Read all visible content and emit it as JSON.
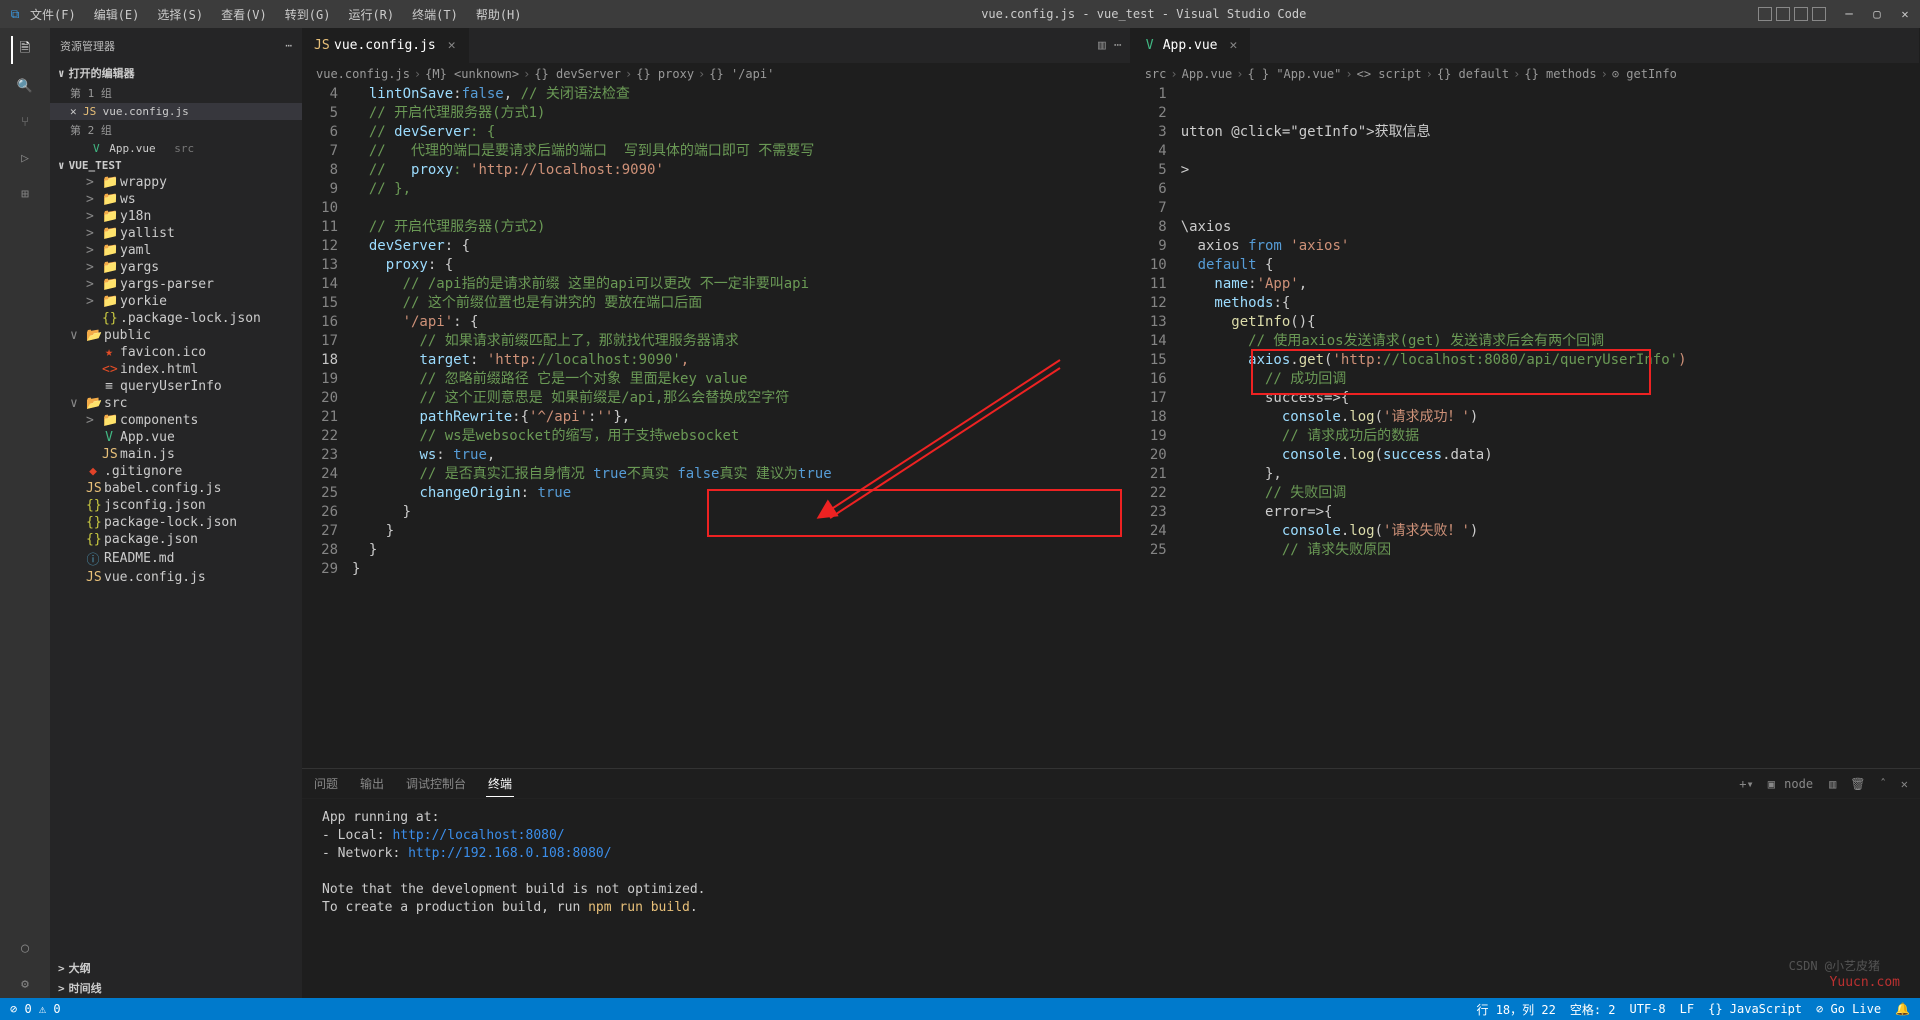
{
  "titlebar": {
    "menu": [
      "文件(F)",
      "编辑(E)",
      "选择(S)",
      "查看(V)",
      "转到(G)",
      "运行(R)",
      "终端(T)",
      "帮助(H)"
    ],
    "title": "vue.config.js - vue_test - Visual Studio Code"
  },
  "sidebar": {
    "header": "资源管理器",
    "openEditors": "打开的编辑器",
    "group1": "第 1 组",
    "group2": "第 2 组",
    "file1": "vue.config.js",
    "file2": "App.vue",
    "file2hint": "src",
    "project": "VUE_TEST",
    "tree": [
      {
        "indent": 1,
        "type": "folder",
        "chev": ">",
        "name": "wrappy"
      },
      {
        "indent": 1,
        "type": "folder",
        "chev": ">",
        "name": "ws"
      },
      {
        "indent": 1,
        "type": "folder",
        "chev": ">",
        "name": "y18n"
      },
      {
        "indent": 1,
        "type": "folder",
        "chev": ">",
        "name": "yallist"
      },
      {
        "indent": 1,
        "type": "folder",
        "chev": ">",
        "name": "yaml"
      },
      {
        "indent": 1,
        "type": "folder",
        "chev": ">",
        "name": "yargs"
      },
      {
        "indent": 1,
        "type": "folder",
        "chev": ">",
        "name": "yargs-parser"
      },
      {
        "indent": 1,
        "type": "folder",
        "chev": ">",
        "name": "yorkie"
      },
      {
        "indent": 1,
        "type": "json",
        "chev": "",
        "name": ".package-lock.json"
      },
      {
        "indent": 0,
        "type": "folder-open",
        "chev": "∨",
        "name": "public"
      },
      {
        "indent": 1,
        "type": "ico",
        "chev": "",
        "name": "favicon.ico"
      },
      {
        "indent": 1,
        "type": "html",
        "chev": "",
        "name": "index.html"
      },
      {
        "indent": 1,
        "type": "file",
        "chev": "",
        "name": "queryUserInfo"
      },
      {
        "indent": 0,
        "type": "folder-open",
        "chev": "∨",
        "name": "src"
      },
      {
        "indent": 1,
        "type": "folder",
        "chev": ">",
        "name": "components"
      },
      {
        "indent": 1,
        "type": "vue",
        "chev": "",
        "name": "App.vue"
      },
      {
        "indent": 1,
        "type": "js",
        "chev": "",
        "name": "main.js"
      },
      {
        "indent": 0,
        "type": "git",
        "chev": "",
        "name": ".gitignore"
      },
      {
        "indent": 0,
        "type": "js",
        "chev": "",
        "name": "babel.config.js"
      },
      {
        "indent": 0,
        "type": "json",
        "chev": "",
        "name": "jsconfig.json"
      },
      {
        "indent": 0,
        "type": "json",
        "chev": "",
        "name": "package-lock.json"
      },
      {
        "indent": 0,
        "type": "json",
        "chev": "",
        "name": "package.json"
      },
      {
        "indent": 0,
        "type": "md",
        "chev": "",
        "name": "README.md"
      },
      {
        "indent": 0,
        "type": "js",
        "chev": "",
        "name": "vue.config.js",
        "sel": true
      }
    ],
    "outline": "大纲",
    "timeline": "时间线"
  },
  "editor1": {
    "tab": "vue.config.js",
    "breadcrumb": [
      "vue.config.js",
      "{M} <unknown>",
      "{} devServer",
      "{} proxy",
      "{} '/api'"
    ],
    "startLine": 4,
    "currentLine": 18,
    "lines": [
      "  lintOnSave:false, // 关闭语法检查",
      "  // 开启代理服务器(方式1)",
      "  // devServer: {",
      "  //   代理的端口是要请求后端的端口  写到具体的端口即可 不需要写",
      "  //   proxy: 'http://localhost:9090'",
      "  // },",
      "",
      "  // 开启代理服务器(方式2)",
      "  devServer: {",
      "    proxy: {",
      "      // /api指的是请求前缀 这里的api可以更改 不一定非要叫api",
      "      // 这个前缀位置也是有讲究的 要放在端口后面",
      "      '/api': {",
      "        // 如果请求前缀匹配上了，那就找代理服务器请求",
      "        target: 'http://localhost:9090',",
      "        // 忽略前缀路径 它是一个对象 里面是key value",
      "        // 这个正则意思是 如果前缀是/api,那么会替换成空字符",
      "        pathRewrite:{'^/api':''},",
      "        // ws是websocket的缩写，用于支持websocket",
      "        ws: true,",
      "        // 是否真实汇报自身情况 true不真实 false真实 建议为true",
      "        changeOrigin: true",
      "      }",
      "    }",
      "  }",
      "}"
    ]
  },
  "editor2": {
    "tab": "App.vue",
    "breadcrumb": [
      "src",
      "App.vue",
      "{ } \"App.vue\"",
      "<> script",
      "{} default",
      "{} methods",
      "⊙ getInfo"
    ],
    "startLine": 1,
    "lines": [
      "",
      "",
      "utton @click=\"getInfo\">获取信息</button>",
      "",
      ">",
      "",
      "",
      "\\axios",
      "  axios from 'axios'",
      "  default {",
      "    name:'App',",
      "    methods:{",
      "      getInfo(){",
      "        // 使用axios发送请求(get) 发送请求后会有两个回调",
      "        axios.get('http://localhost:8080/api/queryUserInfo')",
      "          // 成功回调",
      "          success=>{",
      "            console.log('请求成功！')",
      "            // 请求成功后的数据",
      "            console.log(success.data)",
      "          },",
      "          // 失败回调",
      "          error=>{",
      "            console.log('请求失败！')",
      "            // 请求失败原因"
    ]
  },
  "panel": {
    "tabs": [
      "问题",
      "输出",
      "调试控制台",
      "终端"
    ],
    "active": 3,
    "shell": "node",
    "content": [
      "App running at:",
      "- Local:   http://localhost:8080/",
      "- Network: http://192.168.0.108:8080/",
      "",
      "Note that the development build is not optimized.",
      "To create a production build, run npm run build."
    ]
  },
  "statusbar": {
    "errors": "⊘ 0 ⚠ 0",
    "line": "行 18，列 22",
    "spaces": "空格: 2",
    "encoding": "UTF-8",
    "eol": "LF",
    "lang": "{} JavaScript",
    "live": "⊘ Go Live",
    "notif": "🔔"
  },
  "watermark": "Yuucn.com",
  "csdn": "CSDN @小艺皮猪"
}
